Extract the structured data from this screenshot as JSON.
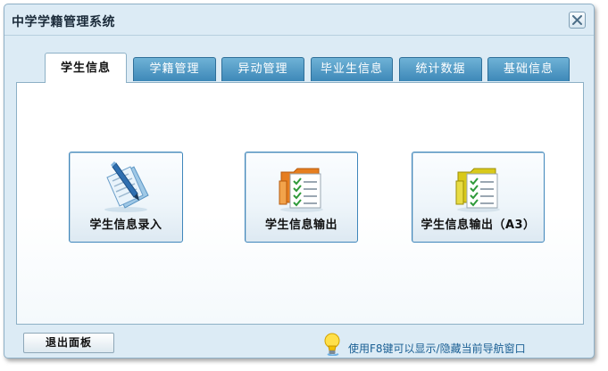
{
  "window": {
    "title": "中学学籍管理系统"
  },
  "tabs": [
    {
      "label": "学生信息",
      "active": true
    },
    {
      "label": "学籍管理",
      "active": false
    },
    {
      "label": "异动管理",
      "active": false
    },
    {
      "label": "毕业生信息",
      "active": false
    },
    {
      "label": "统计数据",
      "active": false
    },
    {
      "label": "基础信息",
      "active": false
    }
  ],
  "panel": {
    "tiles": [
      {
        "label": "学生信息录入",
        "icon": "document-pen-icon"
      },
      {
        "label": "学生信息输出",
        "icon": "folder-checklist-icon"
      },
      {
        "label": "学生信息输出（A3）",
        "icon": "folder-checklist-icon"
      }
    ]
  },
  "footer": {
    "exit_label": "退出面板",
    "hint_text": "使用F8键可以显示/隐藏当前导航窗口",
    "hint_icon": "lightbulb-icon"
  },
  "colors": {
    "window_bg": "#dcebf5",
    "tab_inactive": "#3d88b8",
    "tile_border": "#3f86bb",
    "hint_text": "#1a5f94"
  }
}
